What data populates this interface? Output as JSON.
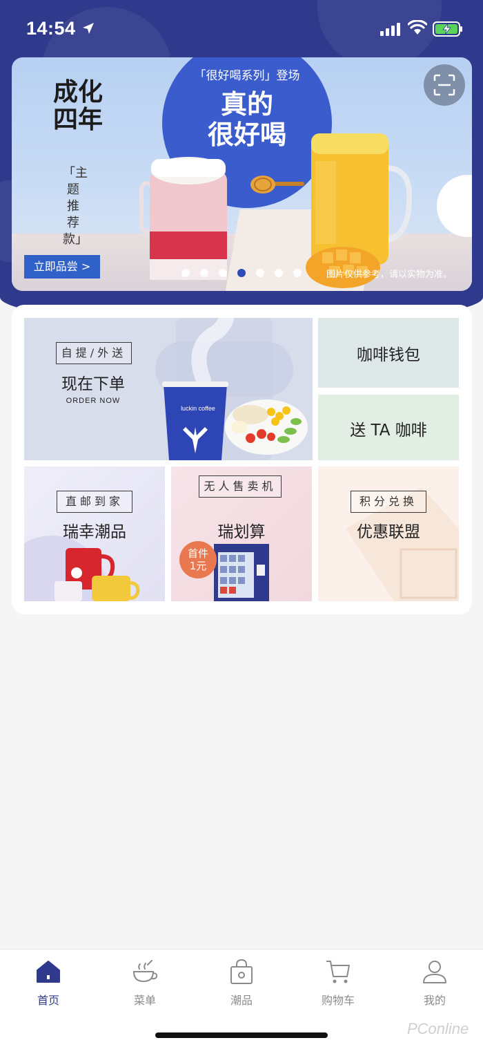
{
  "status_bar": {
    "time": "14:54"
  },
  "banner": {
    "series_tag": "「很好喝系列」登场",
    "headline_line1": "真的",
    "headline_line2": "很好喝",
    "calligraphy": "成化四年",
    "theme_label": "「主题推荐款」",
    "cta_label": "立即品尝 >",
    "disclaimer": "图片仅供参考，请以实物为准。",
    "carousel": {
      "count": 7,
      "active_index": 3
    }
  },
  "tiles": {
    "order": {
      "tag": "自提/外送",
      "title": "现在下单",
      "subtitle": "ORDER NOW",
      "cup_text": "luckin coffee"
    },
    "wallet": {
      "title": "咖啡钱包"
    },
    "gift": {
      "title": "送 TA 咖啡"
    },
    "merch": {
      "tag": "直邮到家",
      "title": "瑞幸潮品"
    },
    "vending": {
      "tag": "无人售卖机",
      "title": "瑞划算",
      "badge_line1": "首件",
      "badge_line2": "1元"
    },
    "points": {
      "tag": "积分兑换",
      "title": "优惠联盟"
    }
  },
  "tab_bar": {
    "active": "home",
    "tabs": [
      {
        "id": "home",
        "label": "首页",
        "icon": "house-icon"
      },
      {
        "id": "menu",
        "label": "菜单",
        "icon": "coffee-cup-icon"
      },
      {
        "id": "merch",
        "label": "潮品",
        "icon": "bag-icon"
      },
      {
        "id": "cart",
        "label": "购物车",
        "icon": "cart-icon"
      },
      {
        "id": "profile",
        "label": "我的",
        "icon": "person-icon"
      }
    ]
  },
  "watermark": "PConline",
  "colors": {
    "brand": "#2f3a8c",
    "accent": "#3061c8",
    "badge": "#e9774f"
  }
}
